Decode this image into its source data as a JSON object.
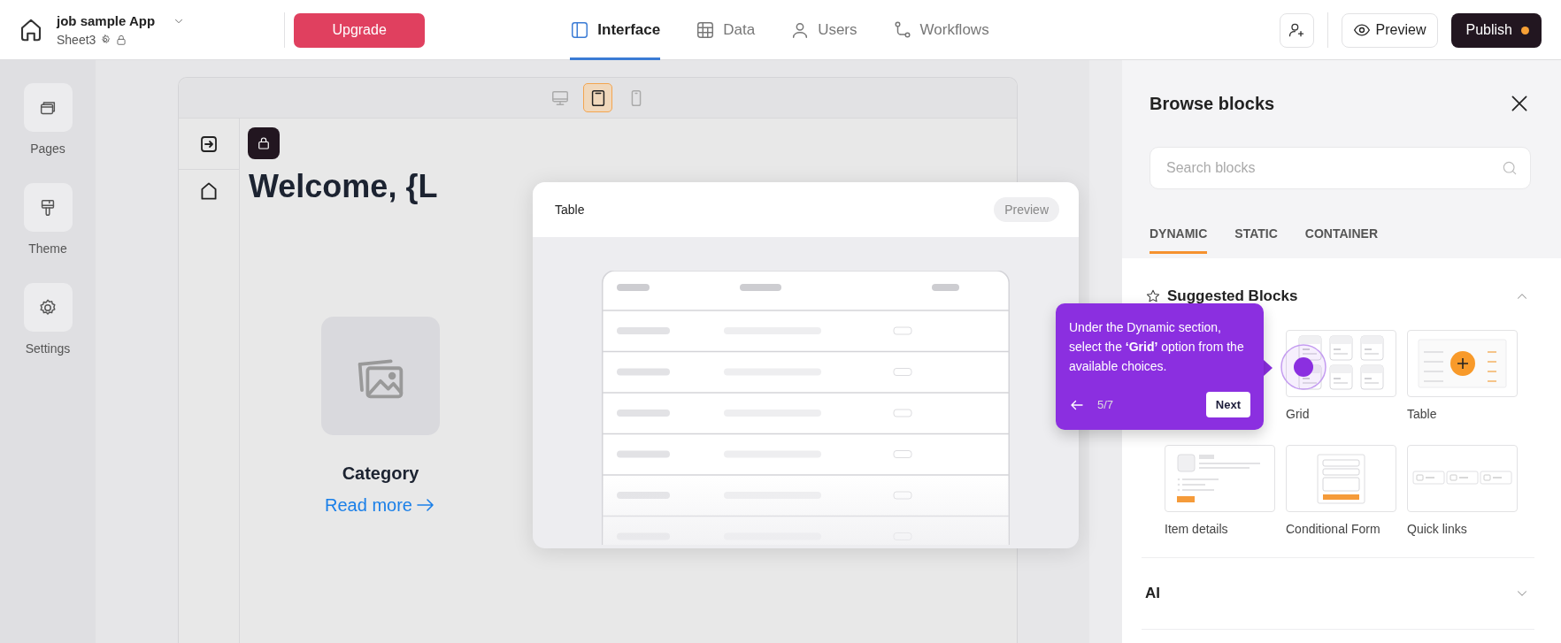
{
  "app": {
    "name": "job sample App",
    "sheet": "Sheet3"
  },
  "upgrade": "Upgrade",
  "nav_tabs": [
    {
      "label": "Interface",
      "kind": "interface",
      "selected": true
    },
    {
      "label": "Data",
      "kind": "data",
      "selected": false
    },
    {
      "label": "Users",
      "kind": "users",
      "selected": false
    },
    {
      "label": "Workflows",
      "kind": "workflows",
      "selected": false
    }
  ],
  "preview": "Preview",
  "publish": {
    "label": "Publish",
    "pending": true
  },
  "rail": [
    {
      "label": "Pages",
      "kind": "pages"
    },
    {
      "label": "Theme",
      "kind": "theme"
    },
    {
      "label": "Settings",
      "kind": "settings"
    }
  ],
  "devices": [
    {
      "kind": "desktop",
      "selected": false
    },
    {
      "kind": "tablet",
      "selected": true
    },
    {
      "kind": "mobile",
      "selected": false
    }
  ],
  "canvas": {
    "heading": "Welcome, {L",
    "card_title": "Category",
    "link": "Read more"
  },
  "block_preview": {
    "title": "Table",
    "button": "Preview"
  },
  "panel": {
    "title": "Browse blocks",
    "search_placeholder": "Search blocks",
    "tabs": [
      {
        "label": "DYNAMIC",
        "selected": true
      },
      {
        "label": "STATIC",
        "selected": false
      },
      {
        "label": "CONTAINER",
        "selected": false
      }
    ],
    "sections": [
      {
        "title": "Suggested Blocks",
        "expanded": true,
        "blocks": [
          {
            "label": "Grid",
            "kind": "grid"
          },
          {
            "label": "Table",
            "kind": "table"
          },
          {
            "label": "Item details",
            "kind": "details"
          },
          {
            "label": "Conditional Form",
            "kind": "form"
          },
          {
            "label": "Quick links",
            "kind": "links"
          }
        ]
      },
      {
        "title": "AI",
        "expanded": false
      }
    ]
  },
  "tour": {
    "text": "Under the Dynamic section, select the **‘Grid’** option from the available choices.",
    "step": "5/7",
    "next": "Next"
  }
}
